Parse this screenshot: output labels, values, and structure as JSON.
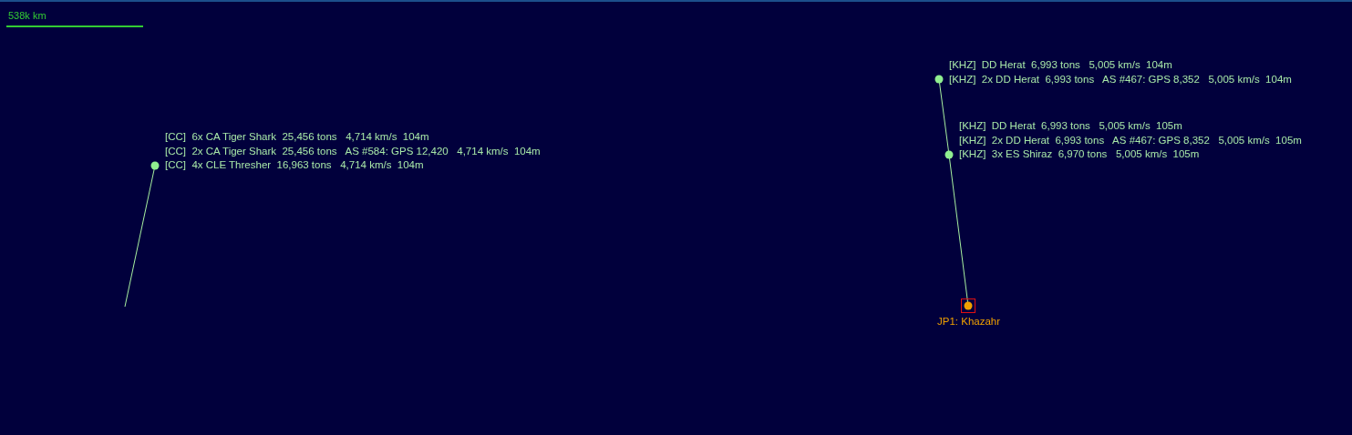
{
  "scale": {
    "label": "538k km"
  },
  "fleets": [
    {
      "lines": [
        "[CC]  6x CA Tiger Shark  25,456 tons   4,714 km/s  104m",
        "[CC]  2x CA Tiger Shark  25,456 tons   AS #584: GPS 12,420   4,714 km/s  104m",
        "[CC]  4x CLE Thresher  16,963 tons   4,714 km/s  104m"
      ]
    },
    {
      "lines": [
        "[KHZ]  DD Herat  6,993 tons   5,005 km/s  104m",
        "[KHZ]  2x DD Herat  6,993 tons   AS #467: GPS 8,352   5,005 km/s  104m"
      ]
    },
    {
      "lines": [
        "[KHZ]  DD Herat  6,993 tons   5,005 km/s  105m",
        "[KHZ]  2x DD Herat  6,993 tons   AS #467: GPS 8,352   5,005 km/s  105m",
        "[KHZ]  3x ES Shiraz  6,970 tons   5,005 km/s  105m"
      ]
    }
  ],
  "jump_points": [
    {
      "label": "JP1: Khazahr"
    }
  ]
}
